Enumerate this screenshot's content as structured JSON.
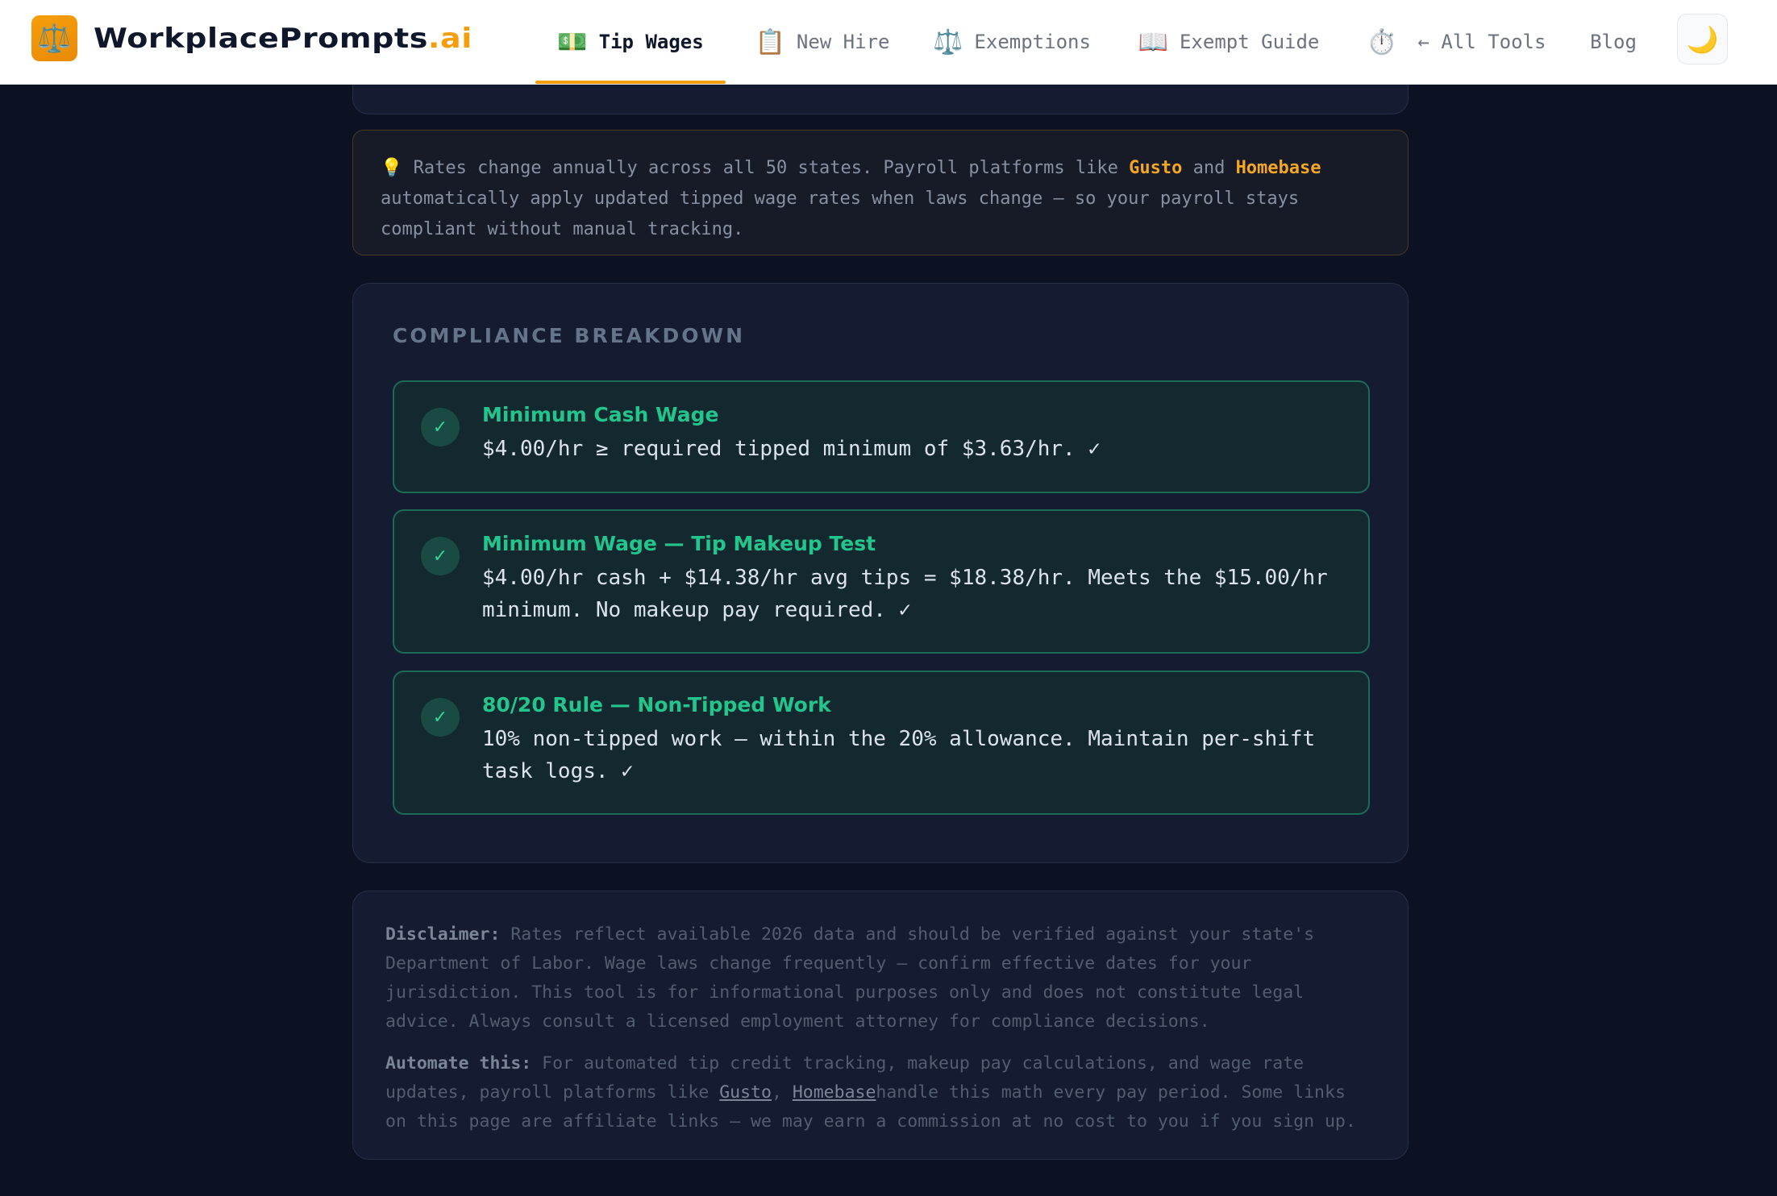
{
  "header": {
    "logo_icon": "⚖️",
    "brand_main": "WorkplacePrompts",
    "brand_accent": ".ai",
    "accent_color": "#f59e0b",
    "nav": [
      {
        "icon": "💵",
        "icon_name": "money-icon",
        "label": "Tip Wages",
        "active": true
      },
      {
        "icon": "📋",
        "icon_name": "clipboard-icon",
        "label": "New Hire"
      },
      {
        "icon": "⚖️",
        "icon_name": "scales-icon",
        "label": "Exemptions"
      },
      {
        "icon": "📖",
        "icon_name": "book-icon",
        "label": "Exempt Guide"
      },
      {
        "icon": "⏱️",
        "icon_name": "stopwatch-icon",
        "label": ""
      },
      {
        "icon": "",
        "label": "← All Tools"
      },
      {
        "icon": "",
        "label": "Blog"
      }
    ],
    "theme_toggle_icon": "🌙"
  },
  "tip": {
    "icon": "💡",
    "text_before": "Rates change annually across all 50 states. Payroll platforms like ",
    "link1": "Gusto",
    "text_mid": " and ",
    "link2": "Homebase",
    "text_after": " automatically apply updated tipped wage rates when laws change — so your payroll stays compliant without manual tracking."
  },
  "breakdown": {
    "title": "COMPLIANCE BREAKDOWN",
    "items": [
      {
        "check": "✓",
        "title": "Minimum Cash Wage",
        "body": "$4.00/hr ≥ required tipped minimum of $3.63/hr. ✓"
      },
      {
        "check": "✓",
        "title": "Minimum Wage — Tip Makeup Test",
        "body": "$4.00/hr cash + $14.38/hr avg tips = $18.38/hr. Meets the $15.00/hr minimum. No makeup pay required. ✓"
      },
      {
        "check": "✓",
        "title": "80/20 Rule — Non-Tipped Work",
        "body": "10% non-tipped work — within the 20% allowance. Maintain per-shift task logs. ✓"
      }
    ]
  },
  "disclaimer": {
    "label": "Disclaimer:",
    "text": " Rates reflect available 2026 data and should be verified against your state's Department of Labor. Wage laws change frequently — confirm effective dates for your jurisdiction. This tool is for informational purposes only and does not constitute legal advice. Always consult a licensed employment attorney for compliance decisions.",
    "automate_label": "Automate this:",
    "automate_before": " For automated tip credit tracking, makeup pay calculations, and wage rate updates, payroll platforms like ",
    "automate_link1": "Gusto",
    "automate_sep": ", ",
    "automate_link2": "Homebase",
    "automate_after": "handle this math every pay period. Some links on this page are affiliate links — we may earn a commission at no cost to you if you sign up."
  }
}
